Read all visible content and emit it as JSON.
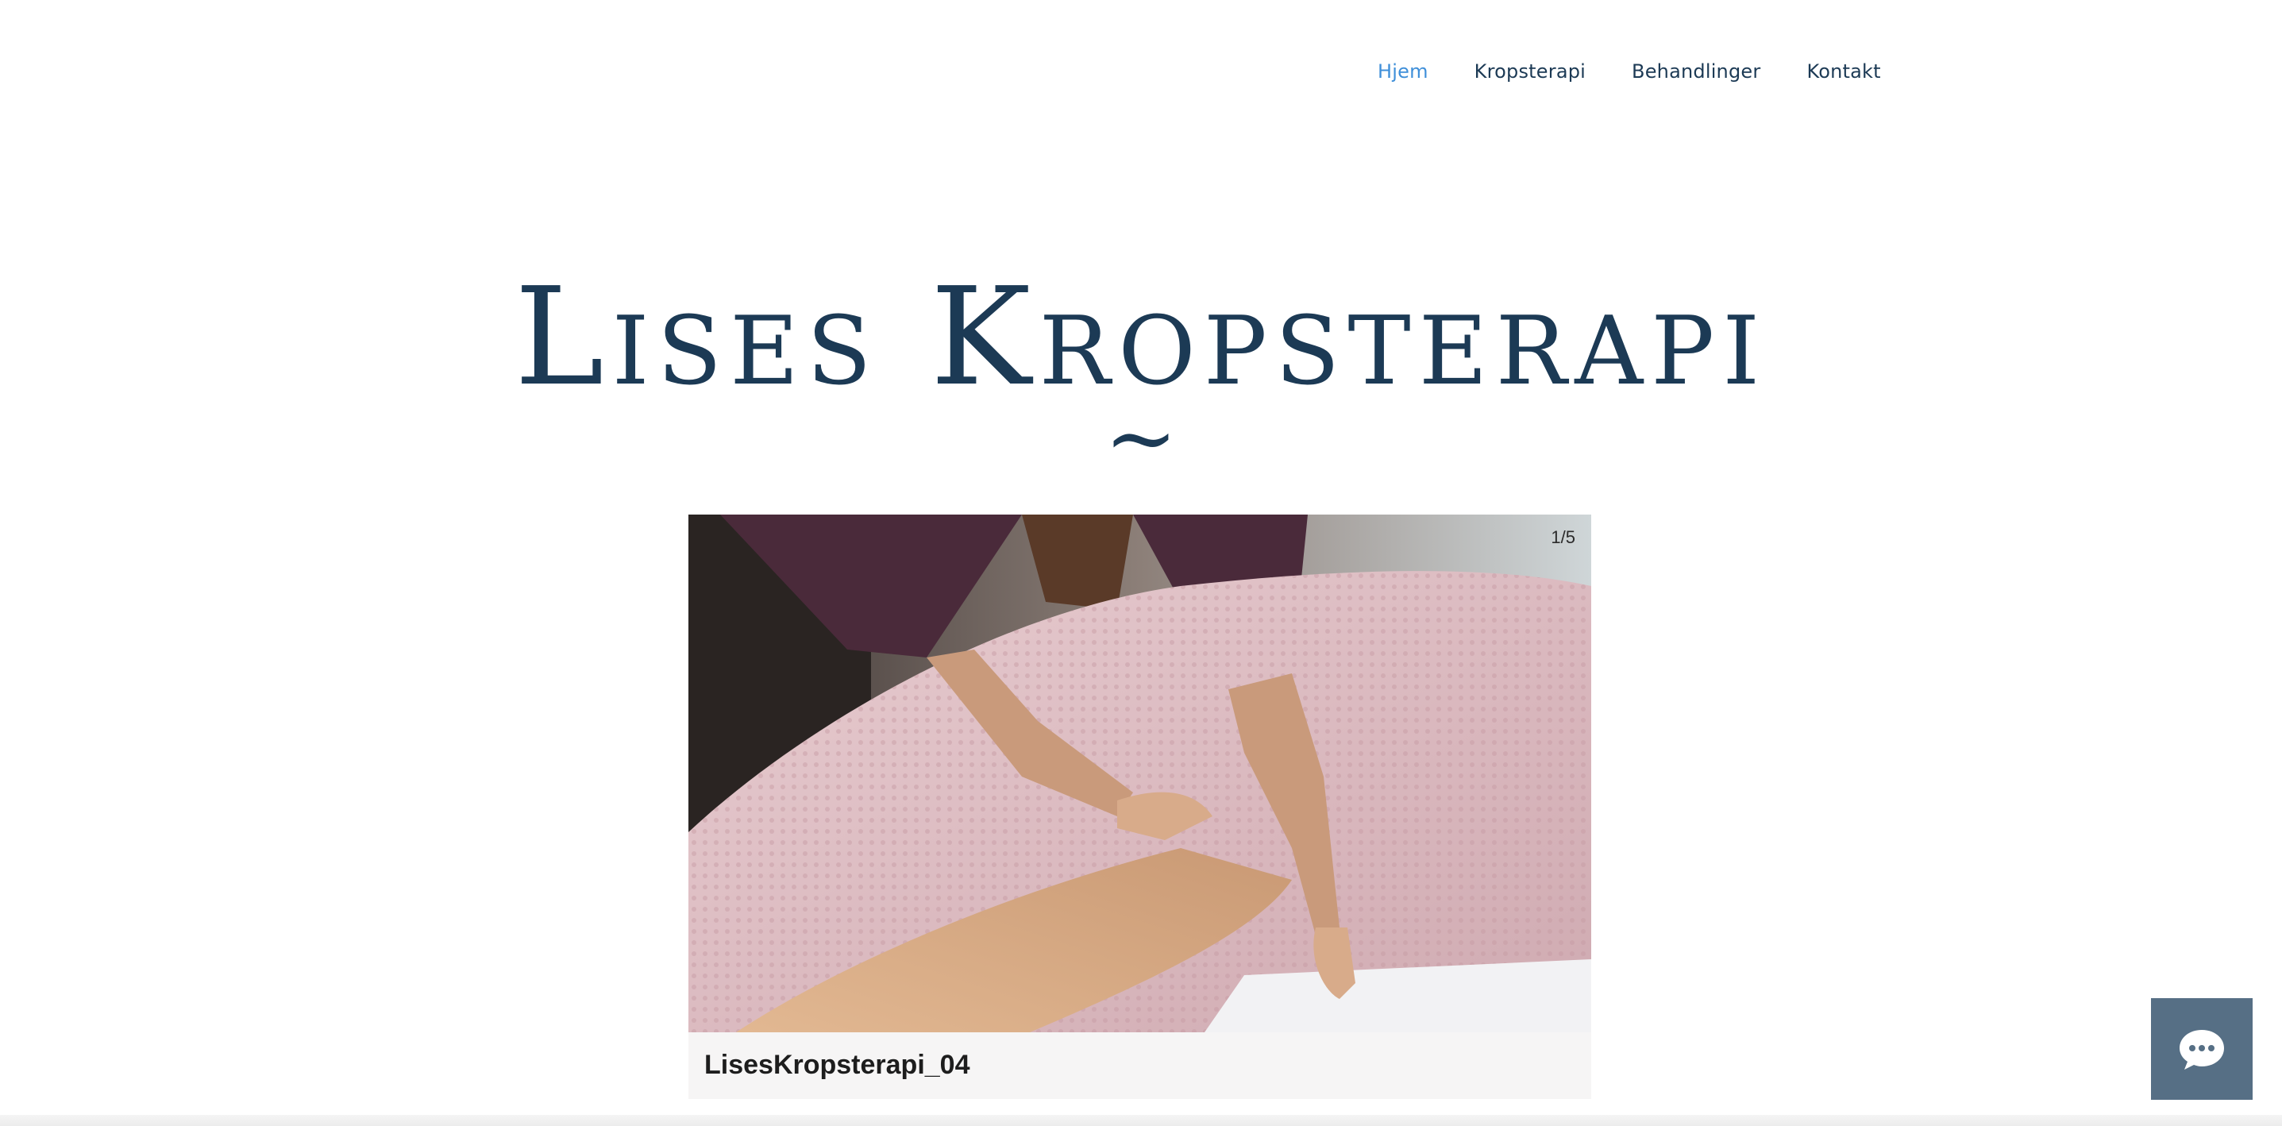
{
  "nav": {
    "items": [
      {
        "label": "Hjem",
        "active": true
      },
      {
        "label": "Kropsterapi",
        "active": false
      },
      {
        "label": "Behandlinger",
        "active": false
      },
      {
        "label": "Kontakt",
        "active": false
      }
    ]
  },
  "hero": {
    "title": "Lises Kropsterapi",
    "ornament": "~"
  },
  "slideshow": {
    "counter": "1/5",
    "caption": "LisesKropsterapi_04"
  },
  "chat": {
    "icon": "chat-bubble-icon"
  },
  "colors": {
    "title": "#1c3a55",
    "nav_active": "#3f8fd9",
    "chat_bg": "#566f85"
  }
}
